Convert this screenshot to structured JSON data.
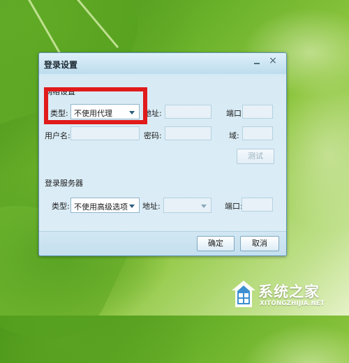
{
  "dialog": {
    "title": "登录设置",
    "title_buttons": {
      "minimize": "minimize",
      "close": "×"
    },
    "proxy_section": {
      "heading": "网络设置",
      "type_label": "类型:",
      "type_value": "不使用代理",
      "address_label": "地址:",
      "address_value": "",
      "port_label": "端口:",
      "port_value": "",
      "username_label": "用户名:",
      "username_value": "",
      "password_label": "密码:",
      "password_value": "",
      "domain_label": "域:",
      "domain_value": "",
      "test_button": "测试"
    },
    "server_section": {
      "heading": "登录服务器",
      "type_label": "类型:",
      "type_value": "不使用高级选项",
      "address_label": "地址:",
      "address_value": "",
      "port_label": "端口:",
      "port_value": ""
    },
    "footer": {
      "ok_button": "确定",
      "cancel_button": "取消"
    }
  },
  "watermark": {
    "brand_cn": "系统之家",
    "brand_url": "XITONGZHIJIA.NET"
  },
  "colors": {
    "highlight": "#e01b1b",
    "dialog_bg": "#dcedf6",
    "background_green": "#6bb22b"
  }
}
